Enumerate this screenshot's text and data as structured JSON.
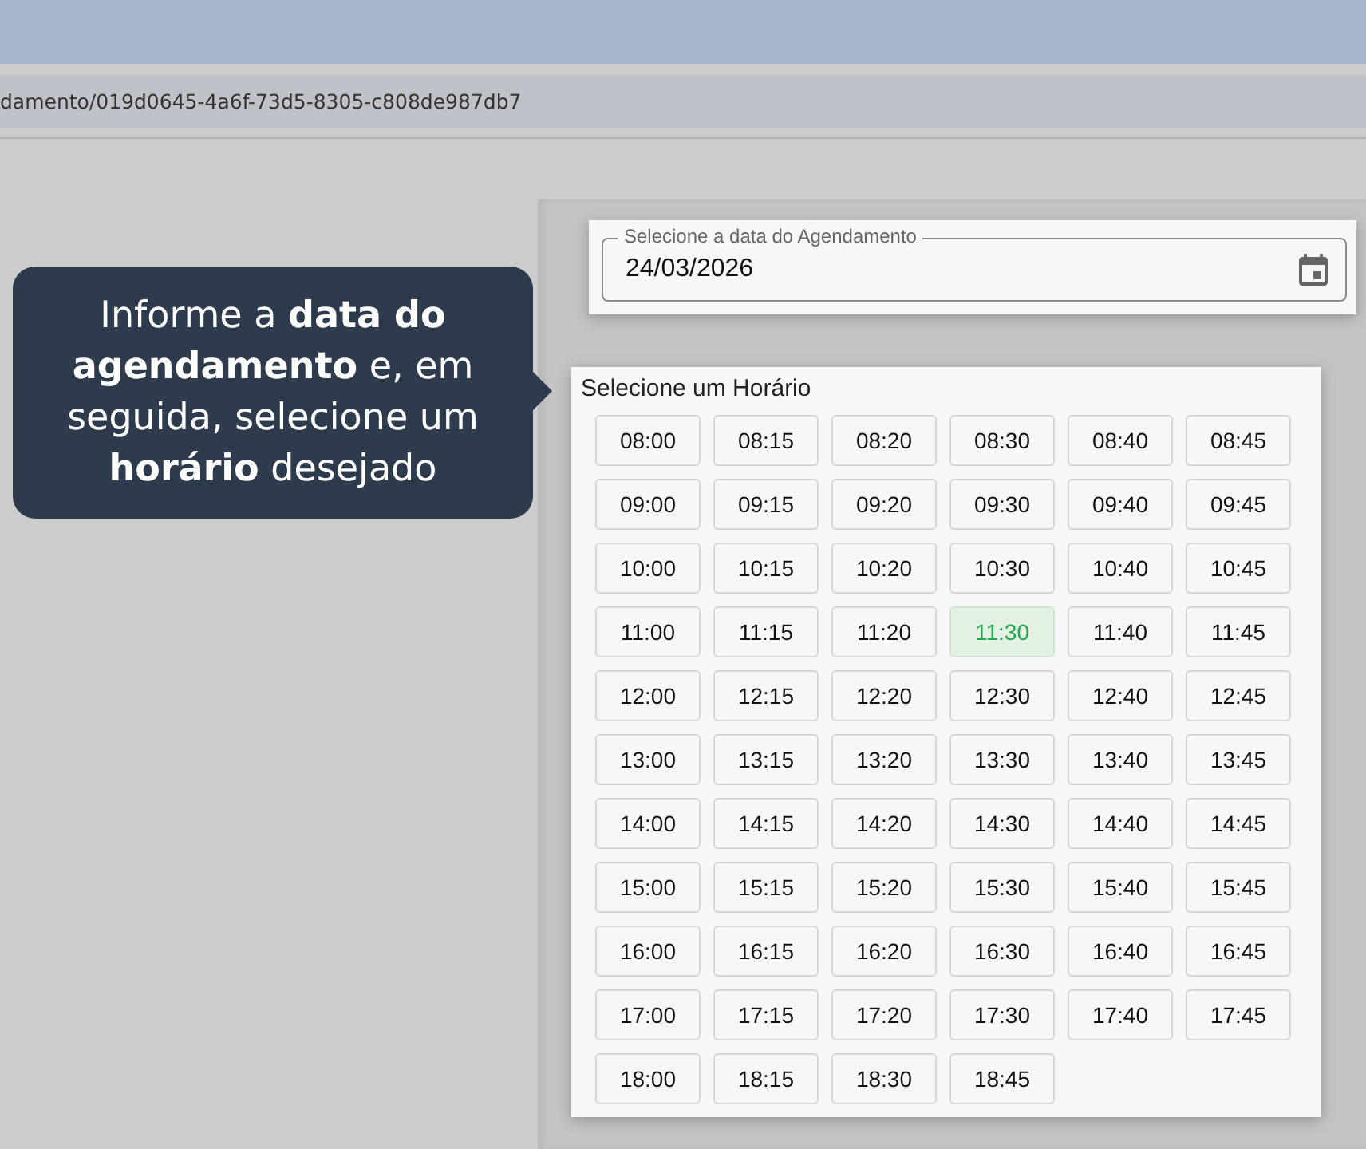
{
  "address_bar": {
    "url": "damento/019d0645-4a6f-73d5-8305-c808de987db7"
  },
  "tooltip": {
    "text": "Informe a **data do agendamento** e, em seguida, selecione um **horário** desejado"
  },
  "date_field": {
    "label": "Selecione a data do Agendamento",
    "value": "24/03/2026"
  },
  "time_picker": {
    "title": "Selecione um Horário",
    "slots": [
      {
        "label": "08:00",
        "selected": false
      },
      {
        "label": "08:15",
        "selected": false
      },
      {
        "label": "08:20",
        "selected": false
      },
      {
        "label": "08:30",
        "selected": false
      },
      {
        "label": "08:40",
        "selected": false
      },
      {
        "label": "08:45",
        "selected": false
      },
      {
        "label": "09:00",
        "selected": false
      },
      {
        "label": "09:15",
        "selected": false
      },
      {
        "label": "09:20",
        "selected": false
      },
      {
        "label": "09:30",
        "selected": false
      },
      {
        "label": "09:40",
        "selected": false
      },
      {
        "label": "09:45",
        "selected": false
      },
      {
        "label": "10:00",
        "selected": false
      },
      {
        "label": "10:15",
        "selected": false
      },
      {
        "label": "10:20",
        "selected": false
      },
      {
        "label": "10:30",
        "selected": false
      },
      {
        "label": "10:40",
        "selected": false
      },
      {
        "label": "10:45",
        "selected": false
      },
      {
        "label": "11:00",
        "selected": false
      },
      {
        "label": "11:15",
        "selected": false
      },
      {
        "label": "11:20",
        "selected": false
      },
      {
        "label": "11:30",
        "selected": true
      },
      {
        "label": "11:40",
        "selected": false
      },
      {
        "label": "11:45",
        "selected": false
      },
      {
        "label": "12:00",
        "selected": false
      },
      {
        "label": "12:15",
        "selected": false
      },
      {
        "label": "12:20",
        "selected": false
      },
      {
        "label": "12:30",
        "selected": false
      },
      {
        "label": "12:40",
        "selected": false
      },
      {
        "label": "12:45",
        "selected": false
      },
      {
        "label": "13:00",
        "selected": false
      },
      {
        "label": "13:15",
        "selected": false
      },
      {
        "label": "13:20",
        "selected": false
      },
      {
        "label": "13:30",
        "selected": false
      },
      {
        "label": "13:40",
        "selected": false
      },
      {
        "label": "13:45",
        "selected": false
      },
      {
        "label": "14:00",
        "selected": false
      },
      {
        "label": "14:15",
        "selected": false
      },
      {
        "label": "14:20",
        "selected": false
      },
      {
        "label": "14:30",
        "selected": false
      },
      {
        "label": "14:40",
        "selected": false
      },
      {
        "label": "14:45",
        "selected": false
      },
      {
        "label": "15:00",
        "selected": false
      },
      {
        "label": "15:15",
        "selected": false
      },
      {
        "label": "15:20",
        "selected": false
      },
      {
        "label": "15:30",
        "selected": false
      },
      {
        "label": "15:40",
        "selected": false
      },
      {
        "label": "15:45",
        "selected": false
      },
      {
        "label": "16:00",
        "selected": false
      },
      {
        "label": "16:15",
        "selected": false
      },
      {
        "label": "16:20",
        "selected": false
      },
      {
        "label": "16:30",
        "selected": false
      },
      {
        "label": "16:40",
        "selected": false
      },
      {
        "label": "16:45",
        "selected": false
      },
      {
        "label": "17:00",
        "selected": false
      },
      {
        "label": "17:15",
        "selected": false
      },
      {
        "label": "17:20",
        "selected": false
      },
      {
        "label": "17:30",
        "selected": false
      },
      {
        "label": "17:40",
        "selected": false
      },
      {
        "label": "17:45",
        "selected": false
      },
      {
        "label": "18:00",
        "selected": false
      },
      {
        "label": "18:15",
        "selected": false
      },
      {
        "label": "18:30",
        "selected": false
      },
      {
        "label": "18:45",
        "selected": false
      }
    ]
  }
}
